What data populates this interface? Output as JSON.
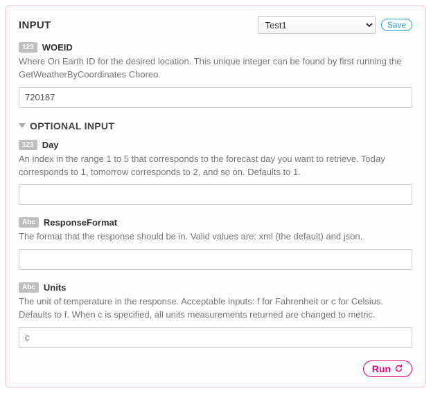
{
  "header": {
    "title": "INPUT",
    "profile_selected": "Test1",
    "save_label": "Save"
  },
  "fields": {
    "woeid": {
      "badge": "123",
      "name": "WOEID",
      "desc": "Where On Earth ID for the desired location. This unique integer can be found by first running the GetWeatherByCoordinates Choreo.",
      "value": "720187"
    }
  },
  "optional_header": "OPTIONAL INPUT",
  "optional": {
    "day": {
      "badge": "123",
      "name": "Day",
      "desc": "An index in the range 1 to 5 that corresponds to the forecast day you want to retrieve. Today corresponds to 1, tomorrow corresponds to 2, and so on. Defaults to 1.",
      "value": ""
    },
    "responseFormat": {
      "badge": "Abc",
      "name": "ResponseFormat",
      "desc": "The format that the response should be in. Valid values are: xml (the default) and json.",
      "value": ""
    },
    "units": {
      "badge": "Abc",
      "name": "Units",
      "desc": "The unit of temperature in the response. Acceptable inputs: f for Fahrenheit or c for Celsius. Defaults to f. When c is specified, all units measurements returned are changed to metric.",
      "value": "c"
    }
  },
  "footer": {
    "run_label": "Run"
  }
}
